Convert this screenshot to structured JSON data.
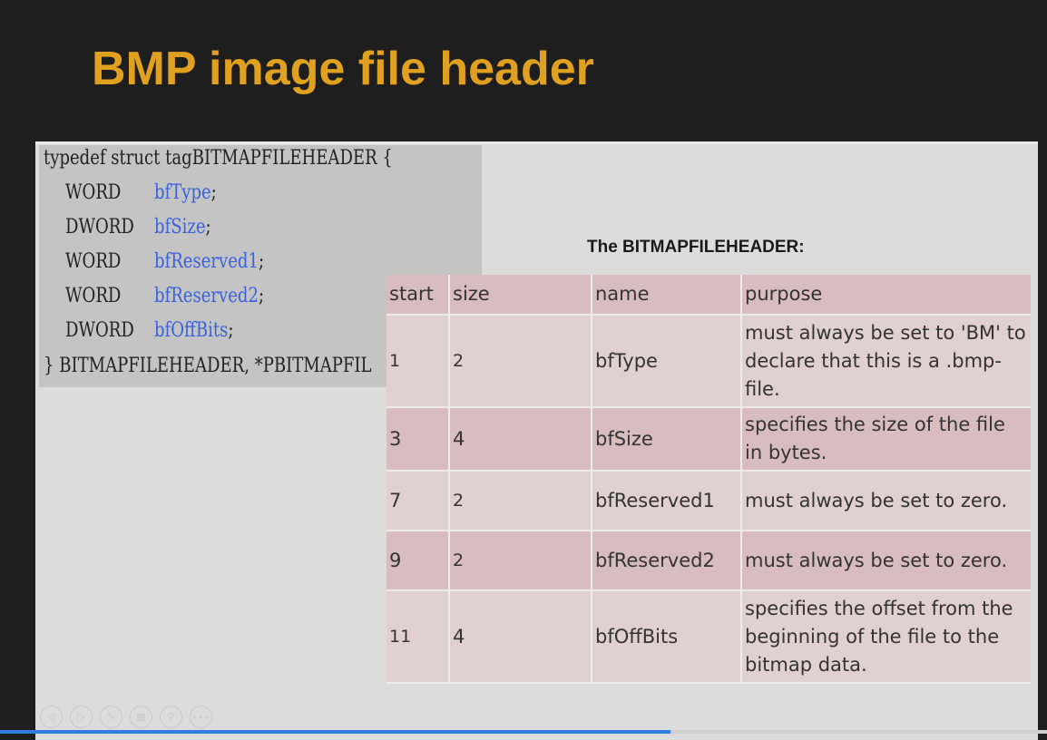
{
  "slide": {
    "title": "BMP image file header",
    "caption": "The BITMAPFILEHEADER:"
  },
  "code": {
    "line_open": "typedef struct tagBITMAPFILEHEADER {",
    "fields": [
      {
        "type": "WORD",
        "name": "bfType",
        "semi": ";"
      },
      {
        "type": "DWORD",
        "name": "bfSize",
        "semi": ";"
      },
      {
        "type": "WORD",
        "name": "bfReserved1",
        "semi": ";"
      },
      {
        "type": "WORD",
        "name": "bfReserved2",
        "semi": ";"
      },
      {
        "type": "DWORD",
        "name": "bfOffBits",
        "semi": ";"
      }
    ],
    "line_close": "} BITMAPFILEHEADER, *PBITMAPFIL"
  },
  "table": {
    "headers": [
      "start",
      "size",
      "name",
      "purpose"
    ],
    "rows": [
      {
        "start": "1",
        "size": "2",
        "name": "bfType",
        "purpose": "must always be set to 'BM' to declare that this is a .bmp-file."
      },
      {
        "start": "3",
        "size": "4",
        "name": "bfSize",
        "purpose": "specifies the size of the file in bytes."
      },
      {
        "start": "7",
        "size": "2",
        "name": "bfReserved1",
        "purpose": "must always be set to zero."
      },
      {
        "start": "9",
        "size": "2",
        "name": "bfReserved2",
        "purpose": "must always be set to zero."
      },
      {
        "start": "11",
        "size": "4",
        "name": "bfOffBits",
        "purpose": "specifies the offset from the beginning of the file to the bitmap data."
      }
    ]
  },
  "nav": {
    "icons": [
      "previous-slide-icon",
      "next-slide-icon",
      "pen-icon",
      "slides-grid-icon",
      "zoom-icon",
      "more-options-icon"
    ],
    "glyphs": [
      "◁",
      "▷",
      "✎",
      "▦",
      "⚲",
      "∘∘∘"
    ]
  },
  "presentation": {
    "progress_fraction": 0.64
  },
  "colors": {
    "title": "#e0a020",
    "code_field": "#3a62d9",
    "row_dark": "#d9bcbf",
    "row_light": "#e0d0d1",
    "progress": "#2f7fe0"
  }
}
